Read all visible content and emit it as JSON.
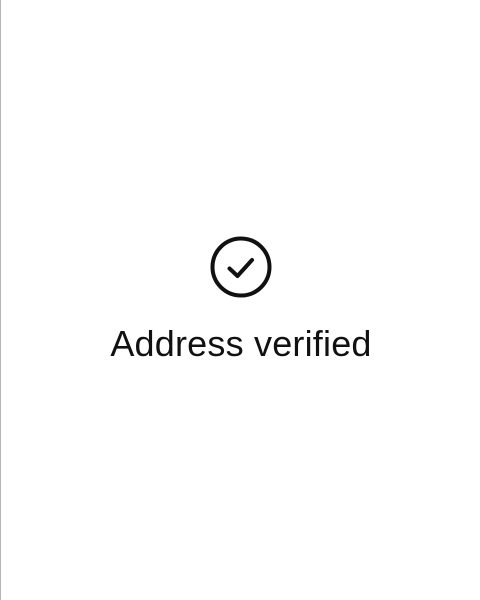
{
  "status": {
    "icon": "check-circle-icon",
    "message": "Address verified"
  },
  "colors": {
    "background": "#ffffff",
    "foreground": "#111111",
    "left_border": "#b5b5b5"
  }
}
